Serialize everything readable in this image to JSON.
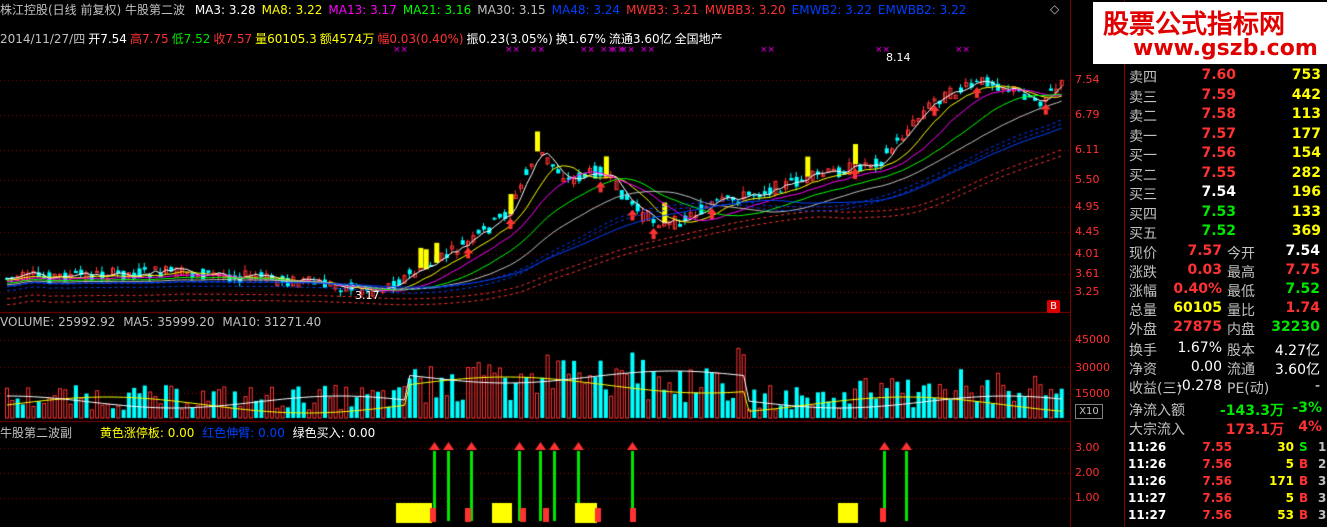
{
  "header": {
    "title": "株江控股(日线 前复权) 牛股第二波",
    "ma": [
      {
        "label": "MA3: 3.28",
        "color": "#ffffff"
      },
      {
        "label": "MA8: 3.22",
        "color": "#ffff00"
      },
      {
        "label": "MA13: 3.17",
        "color": "#ff00ff"
      },
      {
        "label": "MA21: 3.16",
        "color": "#00ff00"
      },
      {
        "label": "MA30: 3.15",
        "color": "#c0c0c0"
      },
      {
        "label": "MA48: 3.24",
        "color": "#0040ff"
      },
      {
        "label": "MWB3: 3.21",
        "color": "#ff3232"
      },
      {
        "label": "MWBB3: 3.20",
        "color": "#ff3232"
      },
      {
        "label": "EMWB2: 3.22",
        "color": "#0040ff"
      },
      {
        "label": "EMWBB2: 3.22",
        "color": "#0040ff"
      }
    ]
  },
  "quote_line": {
    "date": "2014/11/27/四",
    "open": "开7.54",
    "high": "高7.75",
    "low": "低7.52",
    "close": "收7.57",
    "vol": "量60105.3",
    "amount": "额4574万",
    "pct": "幅0.03(0.40%)",
    "amp": "振0.23(3.05%)",
    "turnover": "换1.67%",
    "float": "流通3.60亿",
    "sector": "全国地产"
  },
  "price_axis": [
    "7.54",
    "6.79",
    "6.11",
    "5.50",
    "4.95",
    "4.45",
    "4.01",
    "3.61",
    "3.25"
  ],
  "annotations": {
    "high_label": "8.14",
    "low_label": "3.17",
    "b_badge": "B"
  },
  "volume_panel": {
    "label": "VOLUME: 25992.92",
    "ma5": "MA5: 35999.20",
    "ma10": "MA10: 31271.40",
    "axis": [
      "45000",
      "30000",
      "15000"
    ],
    "unit": "X10"
  },
  "indicator_panel": {
    "label": "牛股第二波副",
    "yellow": "黄色涨停板: 0.00",
    "red": "红色伸臂: 0.00",
    "green": "绿色买入: 0.00",
    "axis": [
      "3.00",
      "2.00",
      "1.00"
    ]
  },
  "brand": {
    "line1": "股票公式指标网",
    "line2": "www.gszb.com"
  },
  "order_book": {
    "asks": [
      {
        "label": "卖四",
        "price": "7.60",
        "vol": "753"
      },
      {
        "label": "卖三",
        "price": "7.59",
        "vol": "442"
      },
      {
        "label": "卖二",
        "price": "7.58",
        "vol": "113"
      },
      {
        "label": "卖一",
        "price": "7.57",
        "vol": "177"
      }
    ],
    "bids": [
      {
        "label": "买一",
        "price": "7.56",
        "vol": "154"
      },
      {
        "label": "买二",
        "price": "7.55",
        "vol": "282"
      },
      {
        "label": "买三",
        "price": "7.54",
        "vol": "196"
      },
      {
        "label": "买四",
        "price": "7.53",
        "vol": "133"
      },
      {
        "label": "买五",
        "price": "7.52",
        "vol": "369"
      }
    ]
  },
  "stats": [
    {
      "l1": "现价",
      "v1": "7.57",
      "c1": "red",
      "l2": "今开",
      "v2": "7.54",
      "c2": "white"
    },
    {
      "l1": "涨跌",
      "v1": "0.03",
      "c1": "red",
      "l2": "最高",
      "v2": "7.75",
      "c2": "red"
    },
    {
      "l1": "涨幅",
      "v1": "0.40%",
      "c1": "red",
      "l2": "最低",
      "v2": "7.52",
      "c2": "green"
    },
    {
      "l1": "总量",
      "v1": "60105",
      "c1": "yellow",
      "l2": "量比",
      "v2": "1.74",
      "c2": "red"
    },
    {
      "l1": "外盘",
      "v1": "27875",
      "c1": "red",
      "l2": "内盘",
      "v2": "32230",
      "c2": "green"
    }
  ],
  "stats2": [
    {
      "l1": "换手",
      "v1": "1.67%",
      "l2": "股本",
      "v2": "4.27亿"
    },
    {
      "l1": "净资",
      "v1": "0.00",
      "l2": "流通",
      "v2": "3.60亿"
    },
    {
      "l1": "收益(三)",
      "v1": "-0.278",
      "l2": "PE(动)",
      "v2": "-"
    }
  ],
  "flow": [
    {
      "l": "净流入额",
      "v": "-143.3万",
      "p": "-3%",
      "vc": "green",
      "pc": "green"
    },
    {
      "l": "大宗流入",
      "v": "173.1万",
      "p": "4%",
      "vc": "red",
      "pc": "red"
    }
  ],
  "trades": [
    {
      "t": "11:26",
      "p": "7.55",
      "v": "30",
      "s": "S",
      "n": "1",
      "sc": "green"
    },
    {
      "t": "11:26",
      "p": "7.56",
      "v": "5",
      "s": "B",
      "n": "2",
      "sc": "red"
    },
    {
      "t": "11:26",
      "p": "7.56",
      "v": "171",
      "s": "B",
      "n": "3",
      "sc": "red"
    },
    {
      "t": "11:27",
      "p": "7.56",
      "v": "5",
      "s": "B",
      "n": "3",
      "sc": "red"
    },
    {
      "t": "11:27",
      "p": "7.56",
      "v": "53",
      "s": "B",
      "n": "3",
      "sc": "red"
    }
  ]
}
